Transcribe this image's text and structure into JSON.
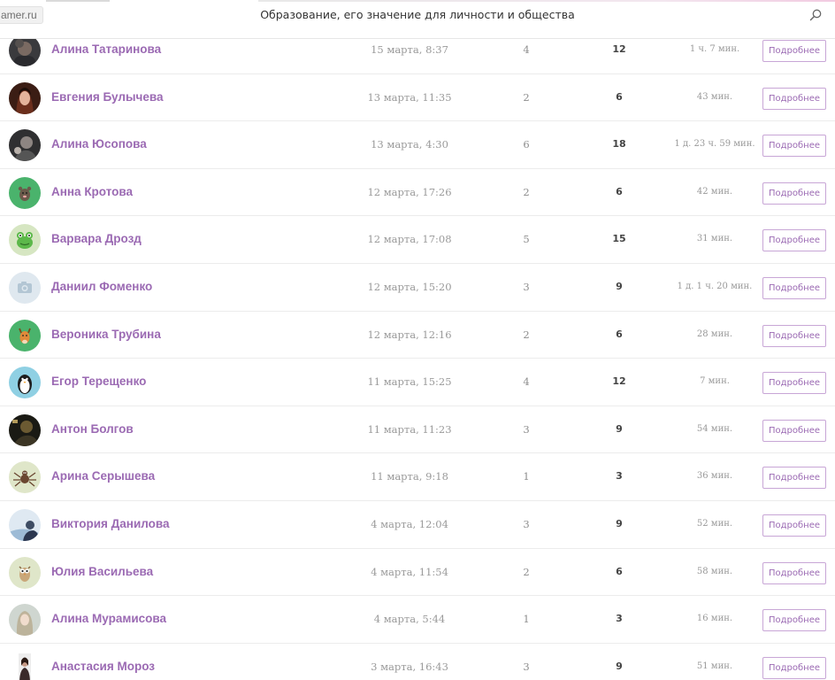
{
  "header": {
    "site": "amer.ru",
    "title": "Образование, его значение для личности и общества"
  },
  "button_label": "Подробнее",
  "colors": {
    "accent": "#9b6ab3",
    "button_border": "#c8a6d6",
    "muted_text": "#9a9a9a"
  },
  "rows": [
    {
      "name": "Алина Татаринова",
      "date": "15 марта, 8:37",
      "count": "4",
      "score": "12",
      "duration": "1 ч. 7 мин.",
      "avatar": "photo-dark"
    },
    {
      "name": "Евгения Булычева",
      "date": "13 марта, 11:35",
      "count": "2",
      "score": "6",
      "duration": "43 мин.",
      "avatar": "photo-warm"
    },
    {
      "name": "Алина Юсопова",
      "date": "13 марта, 4:30",
      "count": "6",
      "score": "18",
      "duration": "1 д. 23 ч. 59 мин.",
      "avatar": "photo-grey"
    },
    {
      "name": "Анна Кротова",
      "date": "12 марта, 17:26",
      "count": "2",
      "score": "6",
      "duration": "42 мин.",
      "avatar": "mole-icon"
    },
    {
      "name": "Варвара Дрозд",
      "date": "12 марта, 17:08",
      "count": "5",
      "score": "15",
      "duration": "31 мин.",
      "avatar": "frog-icon"
    },
    {
      "name": "Даниил Фоменко",
      "date": "12 марта, 15:20",
      "count": "3",
      "score": "9",
      "duration": "1 д. 1 ч. 20 мин.",
      "avatar": "camera-icon"
    },
    {
      "name": "Вероника Трубина",
      "date": "12 марта, 12:16",
      "count": "2",
      "score": "6",
      "duration": "28 мин.",
      "avatar": "deer-icon"
    },
    {
      "name": "Егор Терещенко",
      "date": "11 марта, 15:25",
      "count": "4",
      "score": "12",
      "duration": "7 мин.",
      "avatar": "penguin-icon"
    },
    {
      "name": "Антон Болгов",
      "date": "11 марта, 11:23",
      "count": "3",
      "score": "9",
      "duration": "54 мин.",
      "avatar": "photo-night"
    },
    {
      "name": "Арина Серышева",
      "date": "11 марта, 9:18",
      "count": "1",
      "score": "3",
      "duration": "36 мин.",
      "avatar": "spider-icon"
    },
    {
      "name": "Виктория Данилова",
      "date": "4 марта, 12:04",
      "count": "3",
      "score": "9",
      "duration": "52 мин.",
      "avatar": "photo-blue"
    },
    {
      "name": "Юлия Васильева",
      "date": "4 марта, 11:54",
      "count": "2",
      "score": "6",
      "duration": "58 мин.",
      "avatar": "owl-icon"
    },
    {
      "name": "Алина Мурамисова",
      "date": "4 марта, 5:44",
      "count": "1",
      "score": "3",
      "duration": "16 мин.",
      "avatar": "photo-light"
    },
    {
      "name": "Анастасия Мороз",
      "date": "3 марта, 16:43",
      "count": "3",
      "score": "9",
      "duration": "51 мин.",
      "avatar": "photo-portrait"
    }
  ]
}
